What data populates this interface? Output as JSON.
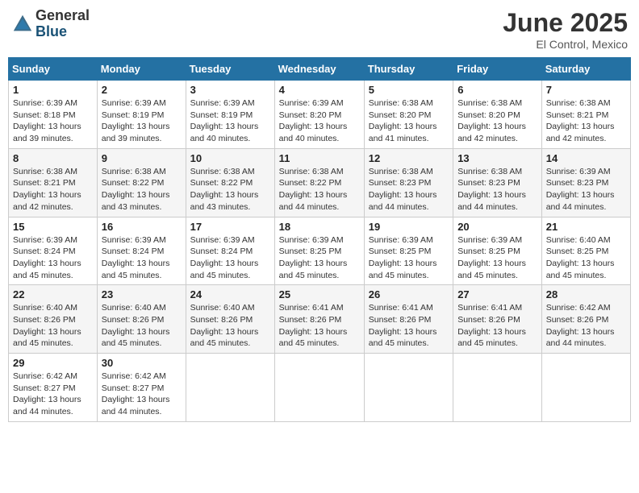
{
  "header": {
    "logo_general": "General",
    "logo_blue": "Blue",
    "month_year": "June 2025",
    "location": "El Control, Mexico"
  },
  "weekdays": [
    "Sunday",
    "Monday",
    "Tuesday",
    "Wednesday",
    "Thursday",
    "Friday",
    "Saturday"
  ],
  "weeks": [
    [
      {
        "day": "1",
        "sunrise": "6:39 AM",
        "sunset": "8:18 PM",
        "daylight": "13 hours and 39 minutes."
      },
      {
        "day": "2",
        "sunrise": "6:39 AM",
        "sunset": "8:19 PM",
        "daylight": "13 hours and 39 minutes."
      },
      {
        "day": "3",
        "sunrise": "6:39 AM",
        "sunset": "8:19 PM",
        "daylight": "13 hours and 40 minutes."
      },
      {
        "day": "4",
        "sunrise": "6:39 AM",
        "sunset": "8:20 PM",
        "daylight": "13 hours and 40 minutes."
      },
      {
        "day": "5",
        "sunrise": "6:38 AM",
        "sunset": "8:20 PM",
        "daylight": "13 hours and 41 minutes."
      },
      {
        "day": "6",
        "sunrise": "6:38 AM",
        "sunset": "8:20 PM",
        "daylight": "13 hours and 42 minutes."
      },
      {
        "day": "7",
        "sunrise": "6:38 AM",
        "sunset": "8:21 PM",
        "daylight": "13 hours and 42 minutes."
      }
    ],
    [
      {
        "day": "8",
        "sunrise": "6:38 AM",
        "sunset": "8:21 PM",
        "daylight": "13 hours and 42 minutes."
      },
      {
        "day": "9",
        "sunrise": "6:38 AM",
        "sunset": "8:22 PM",
        "daylight": "13 hours and 43 minutes."
      },
      {
        "day": "10",
        "sunrise": "6:38 AM",
        "sunset": "8:22 PM",
        "daylight": "13 hours and 43 minutes."
      },
      {
        "day": "11",
        "sunrise": "6:38 AM",
        "sunset": "8:22 PM",
        "daylight": "13 hours and 44 minutes."
      },
      {
        "day": "12",
        "sunrise": "6:38 AM",
        "sunset": "8:23 PM",
        "daylight": "13 hours and 44 minutes."
      },
      {
        "day": "13",
        "sunrise": "6:38 AM",
        "sunset": "8:23 PM",
        "daylight": "13 hours and 44 minutes."
      },
      {
        "day": "14",
        "sunrise": "6:39 AM",
        "sunset": "8:23 PM",
        "daylight": "13 hours and 44 minutes."
      }
    ],
    [
      {
        "day": "15",
        "sunrise": "6:39 AM",
        "sunset": "8:24 PM",
        "daylight": "13 hours and 45 minutes."
      },
      {
        "day": "16",
        "sunrise": "6:39 AM",
        "sunset": "8:24 PM",
        "daylight": "13 hours and 45 minutes."
      },
      {
        "day": "17",
        "sunrise": "6:39 AM",
        "sunset": "8:24 PM",
        "daylight": "13 hours and 45 minutes."
      },
      {
        "day": "18",
        "sunrise": "6:39 AM",
        "sunset": "8:25 PM",
        "daylight": "13 hours and 45 minutes."
      },
      {
        "day": "19",
        "sunrise": "6:39 AM",
        "sunset": "8:25 PM",
        "daylight": "13 hours and 45 minutes."
      },
      {
        "day": "20",
        "sunrise": "6:39 AM",
        "sunset": "8:25 PM",
        "daylight": "13 hours and 45 minutes."
      },
      {
        "day": "21",
        "sunrise": "6:40 AM",
        "sunset": "8:25 PM",
        "daylight": "13 hours and 45 minutes."
      }
    ],
    [
      {
        "day": "22",
        "sunrise": "6:40 AM",
        "sunset": "8:26 PM",
        "daylight": "13 hours and 45 minutes."
      },
      {
        "day": "23",
        "sunrise": "6:40 AM",
        "sunset": "8:26 PM",
        "daylight": "13 hours and 45 minutes."
      },
      {
        "day": "24",
        "sunrise": "6:40 AM",
        "sunset": "8:26 PM",
        "daylight": "13 hours and 45 minutes."
      },
      {
        "day": "25",
        "sunrise": "6:41 AM",
        "sunset": "8:26 PM",
        "daylight": "13 hours and 45 minutes."
      },
      {
        "day": "26",
        "sunrise": "6:41 AM",
        "sunset": "8:26 PM",
        "daylight": "13 hours and 45 minutes."
      },
      {
        "day": "27",
        "sunrise": "6:41 AM",
        "sunset": "8:26 PM",
        "daylight": "13 hours and 45 minutes."
      },
      {
        "day": "28",
        "sunrise": "6:42 AM",
        "sunset": "8:26 PM",
        "daylight": "13 hours and 44 minutes."
      }
    ],
    [
      {
        "day": "29",
        "sunrise": "6:42 AM",
        "sunset": "8:27 PM",
        "daylight": "13 hours and 44 minutes."
      },
      {
        "day": "30",
        "sunrise": "6:42 AM",
        "sunset": "8:27 PM",
        "daylight": "13 hours and 44 minutes."
      },
      null,
      null,
      null,
      null,
      null
    ]
  ]
}
